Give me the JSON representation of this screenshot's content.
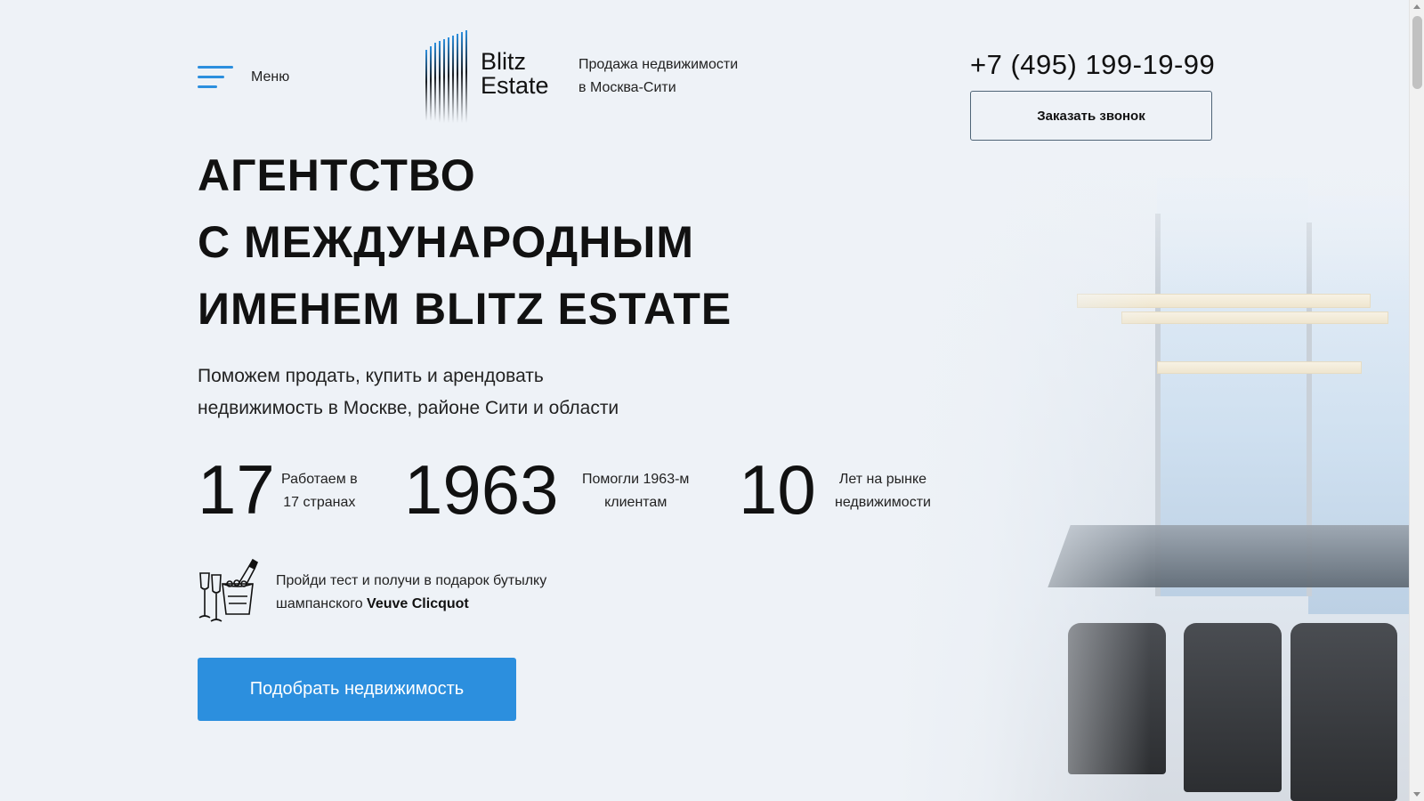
{
  "header": {
    "menu_label": "Меню",
    "logo_line1": "Blitz",
    "logo_line2": "Estate",
    "tagline_line1": "Продажа недвижимости",
    "tagline_line2": "в Москва-Сити",
    "phone": "+7 (495) 199-19-99",
    "callback_label": "Заказать звонок"
  },
  "hero": {
    "title_line1": "АГЕНТСТВО",
    "title_line2": "С МЕЖДУНАРОДНЫМ",
    "title_line3": "ИМЕНЕМ BLITZ ESTATE",
    "subtitle_line1": "Поможем продать, купить и арендовать",
    "subtitle_line2": "недвижимость в Москве, районе Сити и области"
  },
  "stats": [
    {
      "value": "17",
      "label_line1": "Работаем в",
      "label_line2": "17 странах"
    },
    {
      "value": "1963",
      "label_line1": "Помогли 1963-м",
      "label_line2": "клиентам"
    },
    {
      "value": "10",
      "label_line1": "Лет на рынке",
      "label_line2": "недвижимости"
    }
  ],
  "promo": {
    "icon": "champagne-icon",
    "text_line1": "Пройди тест и получи в подарок бутылку",
    "text_line2_prefix": "шампанского",
    "text_brand": "Veuve Clicquot"
  },
  "cta_label": "Подобрать недвижимость",
  "colors": {
    "accent": "#2c8fde",
    "background": "#eef2f7",
    "text": "#111111"
  }
}
